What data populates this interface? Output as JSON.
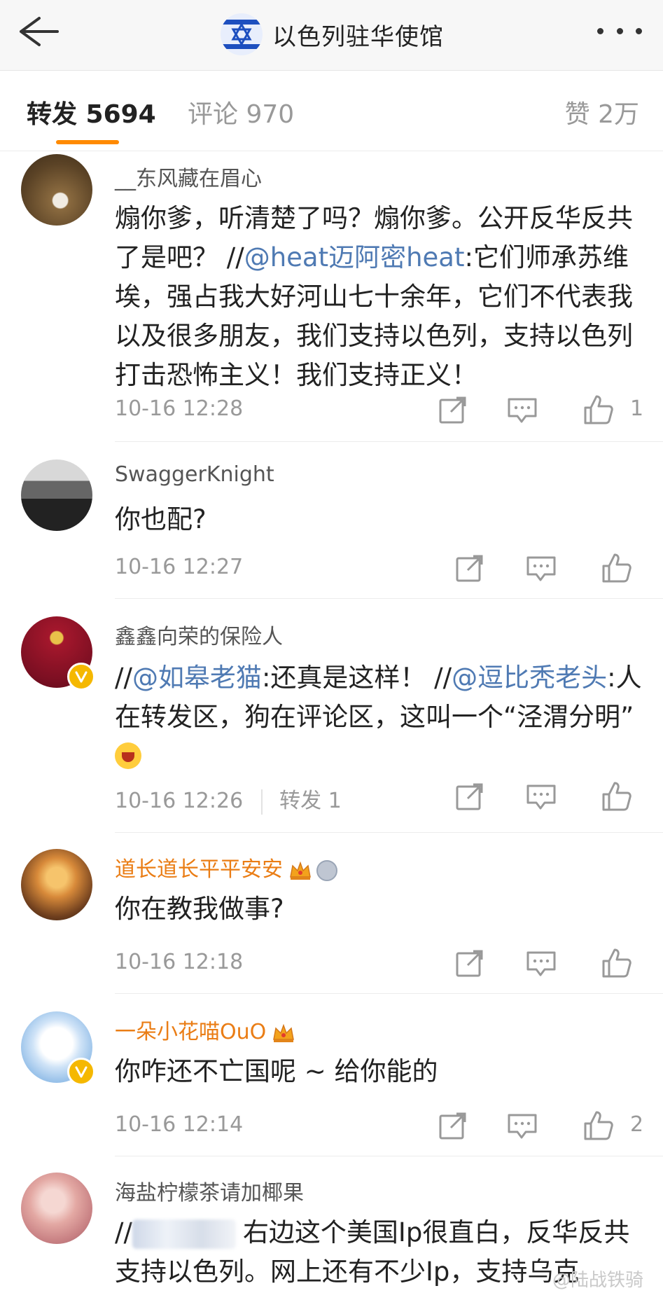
{
  "header": {
    "back_icon": "back-arrow-icon",
    "title": "以色列驻华使馆",
    "more_icon": "more-dots-icon"
  },
  "tabs": {
    "repost": "转发 5694",
    "comment": "评论 970",
    "like": "赞 2万"
  },
  "comments": [
    {
      "name": "__东风藏在眉心",
      "text_before": "煽你爹，听清楚了吗？煽你爹。公开反华反共了是吧？ //",
      "mention": "@heat迈阿密heat",
      "text_after": ":它们师承苏维埃，强占我大好河山七十余年，它们不代表我以及很多朋友，我们支持以色列，支持以色列打击恐怖主义！我们支持正义！",
      "time": "10-16 12:28",
      "likes": "1"
    },
    {
      "name": "SwaggerKnight",
      "text": "你也配?",
      "time": "10-16 12:27"
    },
    {
      "name": "鑫鑫向荣的保险人",
      "text_a": "//",
      "mention1": "@如皋老猫",
      "text_b": ":还真是这样！ //",
      "mention2": "@逗比秃老头",
      "text_c": ":人在转发区，狗在评论区，这叫一个“泾渭分明”",
      "time": "10-16 12:26",
      "repost": "转发 1"
    },
    {
      "name": "道长道长平平安安",
      "text": "你在教我做事?",
      "time": "10-16 12:18"
    },
    {
      "name": "一朵小花喵OuO",
      "text": "你咋还不亡国呢 ~ 给你能的",
      "time": "10-16 12:14",
      "likes": "2"
    },
    {
      "name": "海盐柠檬茶请加椰果",
      "text_a": "//",
      "text_b": "右边这个美国Ip很直白，反华反共支持以色列。网上还有不少Ip，支持乌克"
    }
  ],
  "watermark": "@陆战铁骑",
  "icons": {
    "repost": "share-icon",
    "comment": "comment-icon",
    "like": "thumbs-up-icon"
  },
  "colors": {
    "accent": "#ff8a00",
    "mention": "#4f7ab3",
    "vip_name": "#ea7d15",
    "verified": "#f5b800"
  }
}
